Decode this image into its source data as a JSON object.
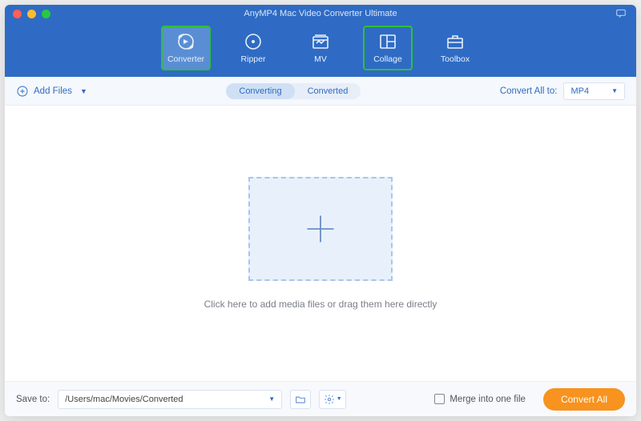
{
  "window": {
    "title": "AnyMP4 Mac Video Converter Ultimate"
  },
  "nav": {
    "converter": "Converter",
    "ripper": "Ripper",
    "mv": "MV",
    "collage": "Collage",
    "toolbox": "Toolbox"
  },
  "sub": {
    "add_files": "Add Files",
    "converting": "Converting",
    "converted": "Converted",
    "convert_all_to": "Convert All to:",
    "format": "MP4"
  },
  "stage": {
    "hint": "Click here to add media files or drag them here directly"
  },
  "footer": {
    "save_to_label": "Save to:",
    "path": "/Users/mac/Movies/Converted",
    "merge_label": "Merge into one file",
    "convert_all": "Convert All"
  }
}
